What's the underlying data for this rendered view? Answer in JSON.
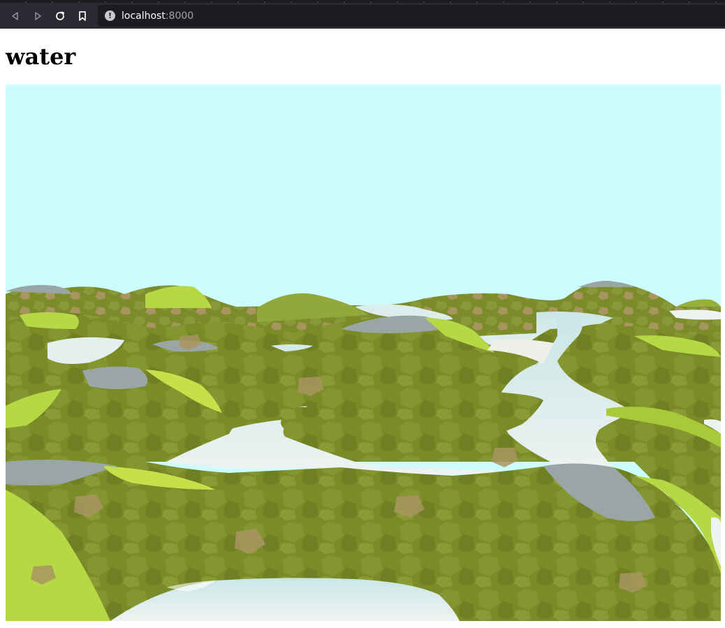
{
  "browser": {
    "url_host": "localhost",
    "url_port": ":8000",
    "icons": {
      "back": "back-arrow-icon",
      "forward": "forward-arrow-icon",
      "reload": "reload-icon",
      "bookmark": "bookmark-icon",
      "site_info": "info-icon"
    }
  },
  "page": {
    "heading": "water"
  },
  "scene": {
    "colors": {
      "sky": "#ccfcfe",
      "grass_dark": "#7a8b27",
      "grass_light": "#a8c93a",
      "grass_bright": "#c6e04a",
      "dirt": "#a89560",
      "rock": "#9aa6a6",
      "water": "#dcedee"
    }
  }
}
